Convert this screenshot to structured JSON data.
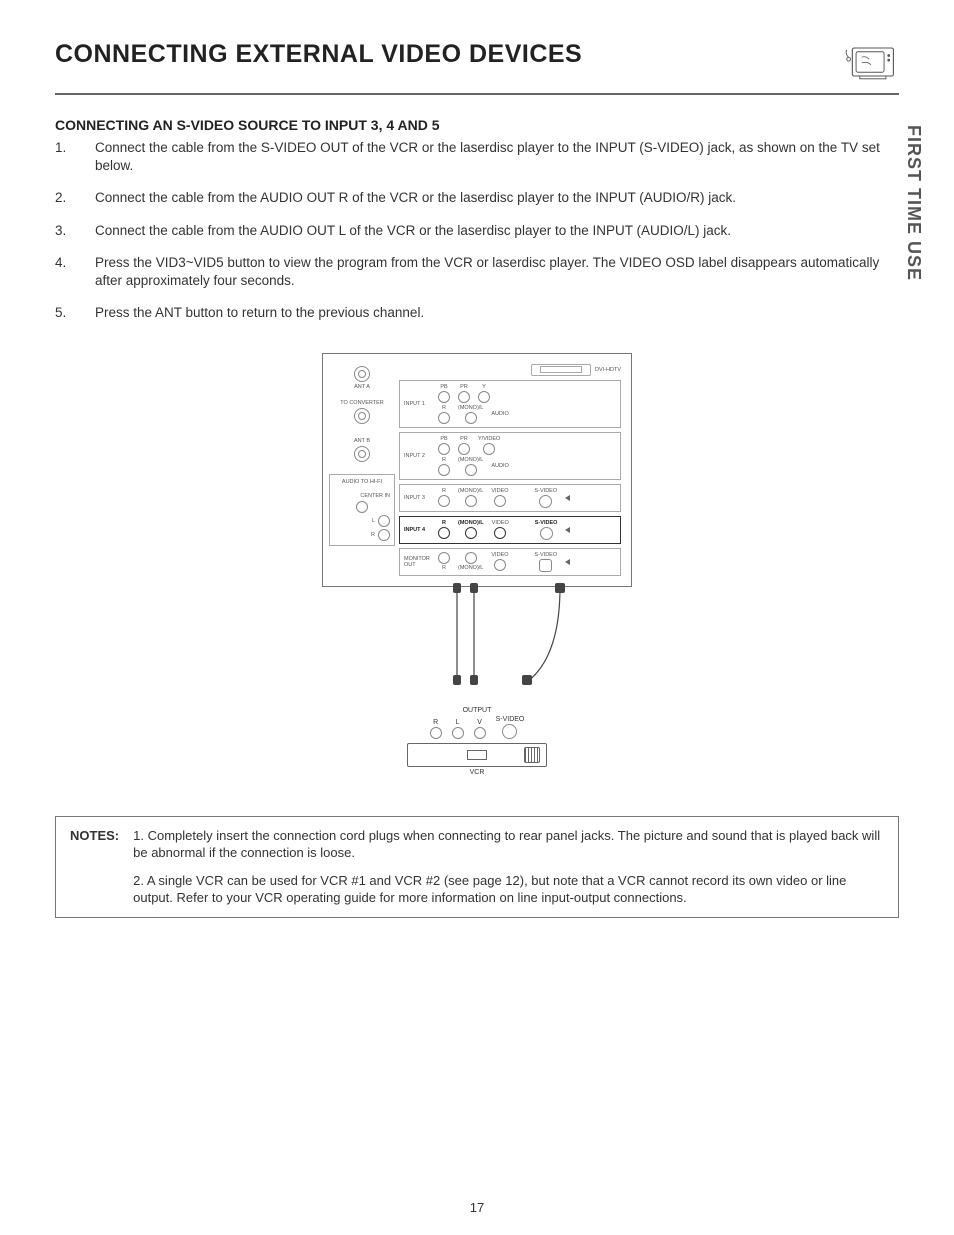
{
  "title": "CONNECTING EXTERNAL VIDEO DEVICES",
  "side_tab": "FIRST TIME USE",
  "section_title": "CONNECTING AN S-VIDEO SOURCE TO INPUT 3, 4 AND 5",
  "steps": [
    "Connect the cable from the S-VIDEO OUT of the VCR or the laserdisc player to the INPUT (S-VIDEO) jack, as shown on the TV set below.",
    "Connect the cable from the AUDIO OUT R of the VCR or the laserdisc player to the INPUT (AUDIO/R) jack.",
    "Connect the cable from the AUDIO OUT L of the VCR or the laserdisc player to the INPUT (AUDIO/L) jack.",
    "Press the VID3~VID5 button to view the program from the VCR or laserdisc player.  The VIDEO OSD label disappears automatically after approximately four seconds.",
    "Press the ANT button to return to the previous channel."
  ],
  "notes_label": "NOTES:",
  "notes": [
    "1.   Completely insert the connection cord plugs when connecting to rear panel jacks.  The picture and sound that is played back will be abnormal if the connection is loose.",
    "2.   A single VCR can be used for VCR #1 and VCR #2 (see page 12), but note that a VCR cannot record its own video or line output.  Refer to your VCR operating guide for more information on line input-output connections."
  ],
  "page_number": "17",
  "diagram": {
    "dvi_label": "DVI-HDTV",
    "left": {
      "ant_a": "ANT A",
      "to_converter": "TO CONVERTER",
      "ant_b": "ANT B",
      "audio_hifi": "AUDIO TO HI-FI",
      "center_in": "CENTER IN",
      "l": "L",
      "r": "R"
    },
    "inputs": {
      "input1": "INPUT 1",
      "input2": "INPUT 2",
      "input3": "INPUT 3",
      "input4": "INPUT 4",
      "monitor_out": "MONITOR OUT"
    },
    "jacks": {
      "pb": "PB",
      "pr": "PR",
      "y": "Y",
      "yvideo": "Y/VIDEO",
      "r": "R",
      "monol": "(MONO)/L",
      "audio": "AUDIO",
      "video": "VIDEO",
      "svideo": "S-VIDEO"
    },
    "vcr": {
      "output": "OUTPUT",
      "r": "R",
      "l": "L",
      "v": "V",
      "svideo": "S-VIDEO",
      "label": "VCR"
    }
  }
}
